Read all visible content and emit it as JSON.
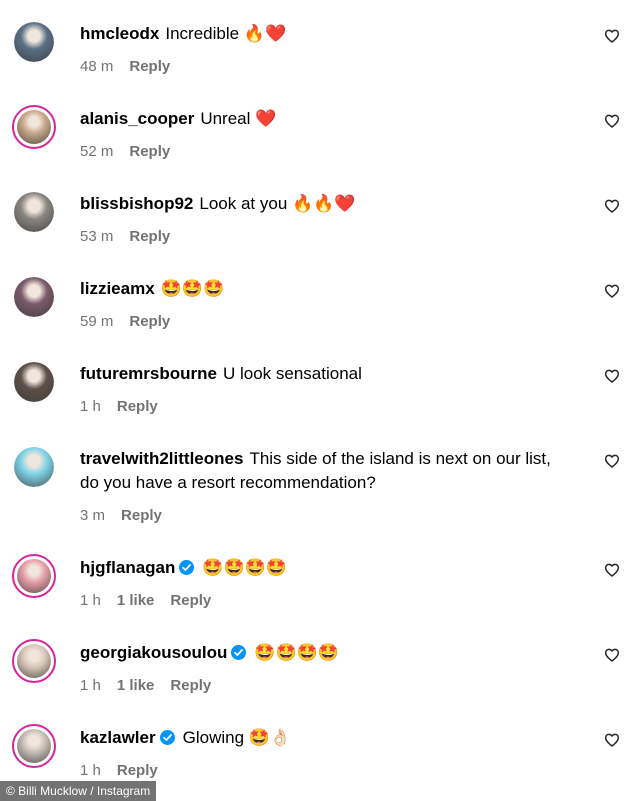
{
  "comments": [
    {
      "username": "hmcleodx",
      "text": "Incredible 🔥❤️",
      "time": "48 m",
      "likes": "",
      "reply": "Reply",
      "verified": false,
      "avatar_color": "#5a6f86",
      "ring": false
    },
    {
      "username": "alanis_cooper",
      "text": "Unreal ❤️",
      "time": "52 m",
      "likes": "",
      "reply": "Reply",
      "verified": false,
      "avatar_color": "#c9a98a",
      "ring": true
    },
    {
      "username": "blissbishop92",
      "text": "Look at you 🔥🔥❤️",
      "time": "53 m",
      "likes": "",
      "reply": "Reply",
      "verified": false,
      "avatar_color": "#8a8580",
      "ring": false
    },
    {
      "username": "lizzieamx",
      "text": "🤩🤩🤩",
      "time": "59 m",
      "likes": "",
      "reply": "Reply",
      "verified": false,
      "avatar_color": "#7a5a6a",
      "ring": false
    },
    {
      "username": "futuremrsbourne",
      "text": "U look sensational",
      "time": "1 h",
      "likes": "",
      "reply": "Reply",
      "verified": false,
      "avatar_color": "#5c5048",
      "ring": false
    },
    {
      "username": "travelwith2littleones",
      "text": "This side of the island is next on our list, do you have a resort recommendation?",
      "time": "3 m",
      "likes": "",
      "reply": "Reply",
      "verified": false,
      "avatar_color": "#7fd3e8",
      "ring": false
    },
    {
      "username": "hjgflanagan",
      "text": "🤩🤩🤩🤩",
      "time": "1 h",
      "likes": "1 like",
      "reply": "Reply",
      "verified": true,
      "avatar_color": "#e8a0a8",
      "ring": true
    },
    {
      "username": "georgiakousoulou",
      "text": "🤩🤩🤩🤩",
      "time": "1 h",
      "likes": "1 like",
      "reply": "Reply",
      "verified": true,
      "avatar_color": "#d9c8b8",
      "ring": true
    },
    {
      "username": "kazlawler",
      "text": "Glowing 🤩👌🏻",
      "time": "1 h",
      "likes": "",
      "reply": "Reply",
      "verified": true,
      "avatar_color": "#c8c0b8",
      "ring": true
    }
  ],
  "caption": "© Billi Mucklow / Instagram",
  "colors": {
    "verified": "#0095f6",
    "ring": "#d6249f",
    "meta": "#737373"
  }
}
